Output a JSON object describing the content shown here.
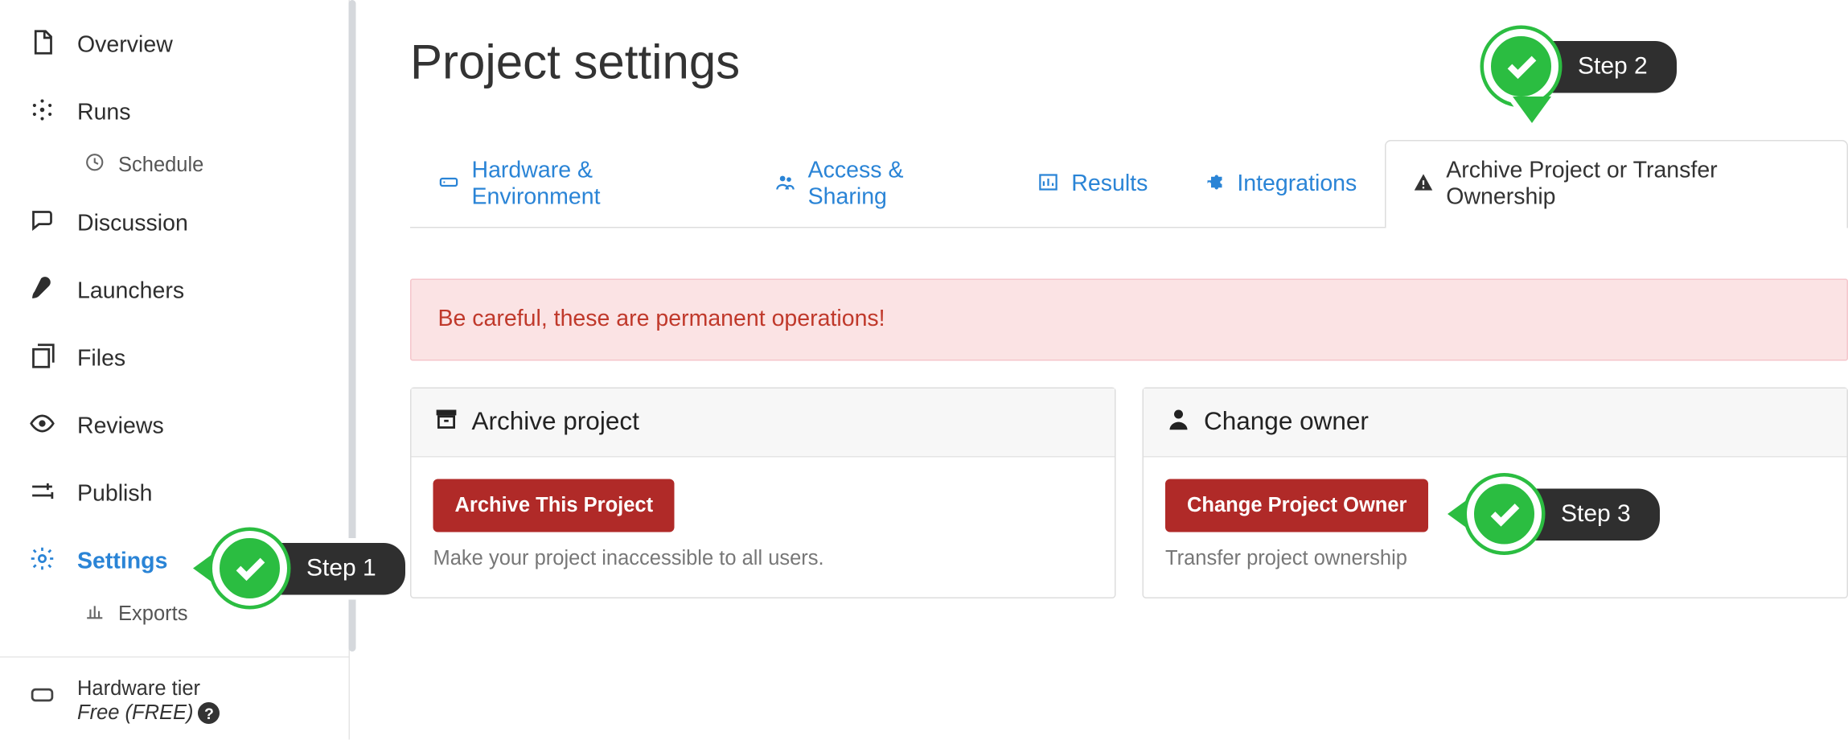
{
  "sidebar": {
    "items": [
      {
        "label": "Overview"
      },
      {
        "label": "Runs"
      },
      {
        "label": "Discussion"
      },
      {
        "label": "Launchers"
      },
      {
        "label": "Files"
      },
      {
        "label": "Reviews"
      },
      {
        "label": "Publish"
      },
      {
        "label": "Settings"
      }
    ],
    "runs_sub": {
      "label": "Schedule"
    },
    "settings_sub": {
      "label": "Exports"
    },
    "hardware": {
      "title": "Hardware tier",
      "value": "Free (FREE)"
    }
  },
  "page": {
    "title": "Project settings"
  },
  "tabs": [
    {
      "label": "Hardware & Environment"
    },
    {
      "label": "Access & Sharing"
    },
    {
      "label": "Results"
    },
    {
      "label": "Integrations"
    },
    {
      "label": "Archive Project or Transfer Ownership"
    }
  ],
  "warning": "Be careful, these are permanent operations!",
  "cards": {
    "archive": {
      "title": "Archive project",
      "button": "Archive This Project",
      "desc": "Make your project inaccessible to all users."
    },
    "owner": {
      "title": "Change owner",
      "button": "Change Project Owner",
      "desc": "Transfer project ownership"
    }
  },
  "callouts": {
    "s1": "Step 1",
    "s2": "Step 2",
    "s3": "Step 3"
  }
}
